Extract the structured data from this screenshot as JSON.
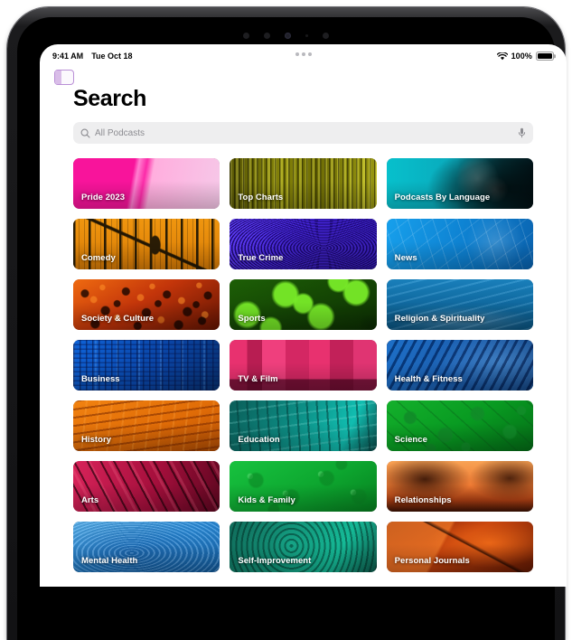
{
  "status_bar": {
    "time": "9:41 AM",
    "date": "Tue Oct 18",
    "wifi_icon": "wifi-icon",
    "battery_percent": "100%",
    "battery_icon": "battery-full-icon",
    "multitask_handle_icon": "multitask-handle-icon"
  },
  "navigation": {
    "sidebar_toggle_icon": "sidebar-toggle-icon"
  },
  "page": {
    "title": "Search"
  },
  "search": {
    "icon": "search-icon",
    "placeholder": "All Podcasts",
    "value": "",
    "mic_icon": "microphone-icon"
  },
  "categories": [
    {
      "label": "Pride 2023",
      "art": "pride",
      "accent": "#f01fa0"
    },
    {
      "label": "Top Charts",
      "art": "topcharts",
      "accent": "#9d9b09"
    },
    {
      "label": "Podcasts By Language",
      "art": "language",
      "accent": "#0cb8c4"
    },
    {
      "label": "Comedy",
      "art": "comedy",
      "accent": "#e08a11"
    },
    {
      "label": "True Crime",
      "art": "truecrime",
      "accent": "#4423e8"
    },
    {
      "label": "News",
      "art": "news",
      "accent": "#0e8fdc"
    },
    {
      "label": "Society & Culture",
      "art": "society",
      "accent": "#d5400c"
    },
    {
      "label": "Sports",
      "art": "sports",
      "accent": "#4ec21a"
    },
    {
      "label": "Religion & Spirituality",
      "art": "religion",
      "accent": "#1178b4"
    },
    {
      "label": "Business",
      "art": "business",
      "accent": "#0b56c9"
    },
    {
      "label": "TV & Film",
      "art": "tvfilm",
      "accent": "#e63172"
    },
    {
      "label": "Health & Fitness",
      "art": "health",
      "accent": "#0e6fd0"
    },
    {
      "label": "History",
      "art": "history",
      "accent": "#e86a0a"
    },
    {
      "label": "Education",
      "art": "education",
      "accent": "#0c8d83"
    },
    {
      "label": "Science",
      "art": "science",
      "accent": "#0c9e25"
    },
    {
      "label": "Arts",
      "art": "arts",
      "accent": "#c21244"
    },
    {
      "label": "Kids & Family",
      "art": "kids",
      "accent": "#11b33c"
    },
    {
      "label": "Relationships",
      "art": "relationships",
      "accent": "#f07a34"
    },
    {
      "label": "Mental Health",
      "art": "mentalhealth",
      "accent": "#2a8fe0"
    },
    {
      "label": "Self-Improvement",
      "art": "selfimprove",
      "accent": "#0f7f66"
    },
    {
      "label": "Personal Journals",
      "art": "journals",
      "accent": "#c2400c"
    }
  ]
}
